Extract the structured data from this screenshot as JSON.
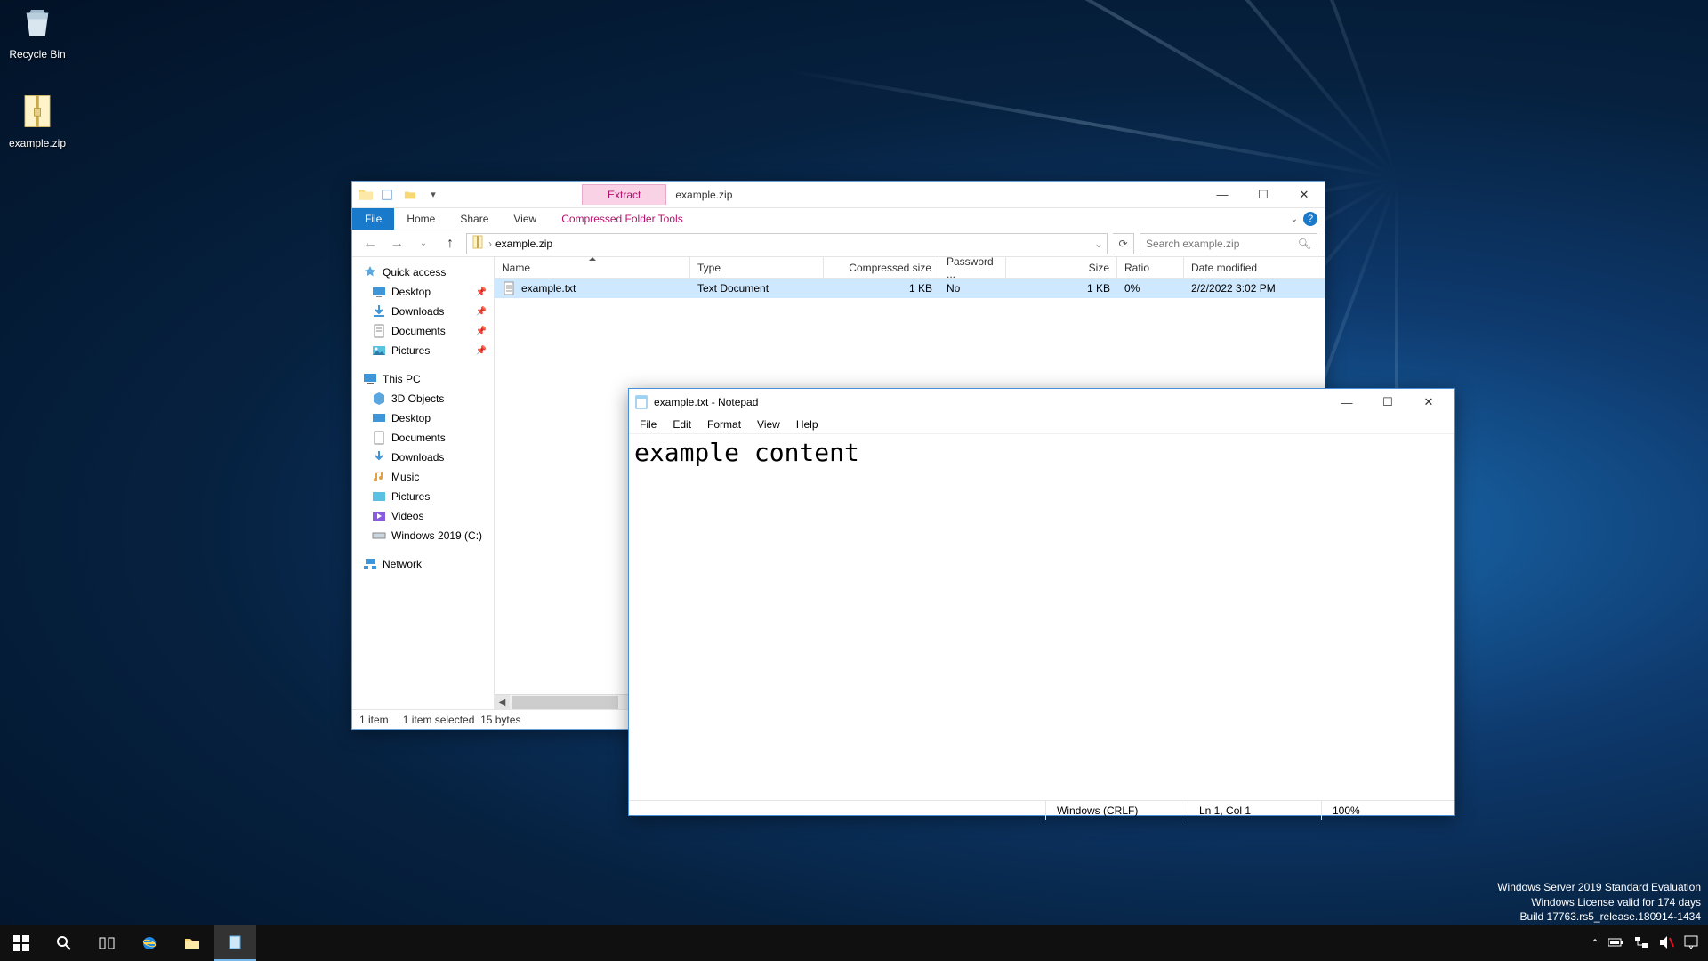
{
  "desktop": {
    "recycle_label": "Recycle Bin",
    "zip_label": "example.zip"
  },
  "watermark": {
    "line1": "Windows Server 2019 Standard Evaluation",
    "line2": "Windows License valid for 174 days",
    "line3": "Build 17763.rs5_release.180914-1434"
  },
  "explorer": {
    "title": "example.zip",
    "context_tab": "Extract",
    "context_group": "Compressed Folder Tools",
    "tabs": {
      "file": "File",
      "home": "Home",
      "share": "Share",
      "view": "View"
    },
    "breadcrumb": "example.zip",
    "search_placeholder": "Search example.zip",
    "nav": {
      "quick_access": "Quick access",
      "desktop": "Desktop",
      "downloads": "Downloads",
      "documents": "Documents",
      "pictures": "Pictures",
      "this_pc": "This PC",
      "objects3d": "3D Objects",
      "desktop2": "Desktop",
      "documents2": "Documents",
      "downloads2": "Downloads",
      "music": "Music",
      "pictures2": "Pictures",
      "videos": "Videos",
      "cdrive": "Windows 2019 (C:)",
      "network": "Network"
    },
    "columns": {
      "name": "Name",
      "type": "Type",
      "csize": "Compressed size",
      "pwd": "Password ...",
      "size": "Size",
      "ratio": "Ratio",
      "date": "Date modified"
    },
    "rows": [
      {
        "name": "example.txt",
        "type": "Text Document",
        "csize": "1 KB",
        "pwd": "No",
        "size": "1 KB",
        "ratio": "0%",
        "date": "2/2/2022 3:02 PM"
      }
    ],
    "status": {
      "count": "1 item",
      "selected": "1 item selected",
      "bytes": "15 bytes"
    }
  },
  "notepad": {
    "title": "example.txt - Notepad",
    "menu": {
      "file": "File",
      "edit": "Edit",
      "format": "Format",
      "view": "View",
      "help": "Help"
    },
    "content": "example content",
    "status": {
      "encoding": "Windows (CRLF)",
      "pos": "Ln 1, Col 1",
      "zoom": "100%"
    }
  }
}
